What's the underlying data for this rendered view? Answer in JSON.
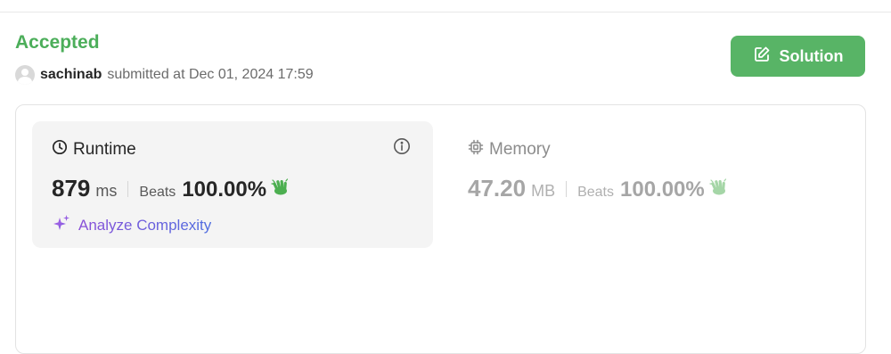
{
  "status": {
    "label": "Accepted",
    "color": "#4cae5a"
  },
  "submission": {
    "username": "sachinab",
    "submitted_text": "submitted at Dec 01, 2024 17:59"
  },
  "solution_button": {
    "label": "Solution",
    "icon": "edit-icon"
  },
  "runtime": {
    "title": "Runtime",
    "icon": "clock-icon",
    "value": "879",
    "unit": "ms",
    "beats_label": "Beats",
    "beats_value": "100.00%",
    "info_icon": "info-icon"
  },
  "memory": {
    "title": "Memory",
    "icon": "chip-icon",
    "value": "47.20",
    "unit": "MB",
    "beats_label": "Beats",
    "beats_value": "100.00%"
  },
  "analyze": {
    "label": "Analyze Complexity",
    "icon": "sparkle-icon"
  },
  "colors": {
    "accent_green": "#58b466",
    "analyze_purple": "#8a4fd8",
    "analyze_blue": "#4f6de0",
    "card_bg": "#f4f4f4"
  }
}
